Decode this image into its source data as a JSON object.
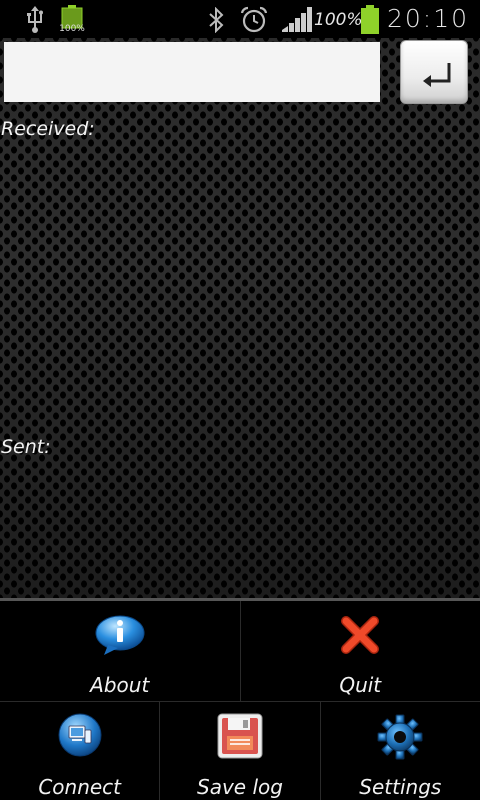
{
  "status_bar": {
    "battery_small_text": "100%",
    "battery_percent": "100%",
    "clock": "20:10",
    "icons": [
      "usb-icon",
      "battery-small-icon",
      "bluetooth-icon",
      "alarm-icon",
      "signal-icon",
      "battery-icon"
    ]
  },
  "terminal": {
    "input_value": "",
    "input_placeholder": "",
    "enter_icon": "enter-icon",
    "received_label": "Received:",
    "sent_label": "Sent:"
  },
  "menu": {
    "items": [
      {
        "label": "About",
        "icon": "info-icon"
      },
      {
        "label": "Quit",
        "icon": "close-icon"
      },
      {
        "label": "Connect",
        "icon": "connect-icon"
      },
      {
        "label": "Save log",
        "icon": "save-icon"
      },
      {
        "label": "Settings",
        "icon": "gear-icon"
      }
    ]
  },
  "colors": {
    "battery_green": "#8fd12a",
    "info_blue": "#2a8fe0",
    "quit_red": "#e03a1e",
    "save_red": "#d9534f",
    "accent_bg": "#2b2b2b"
  }
}
